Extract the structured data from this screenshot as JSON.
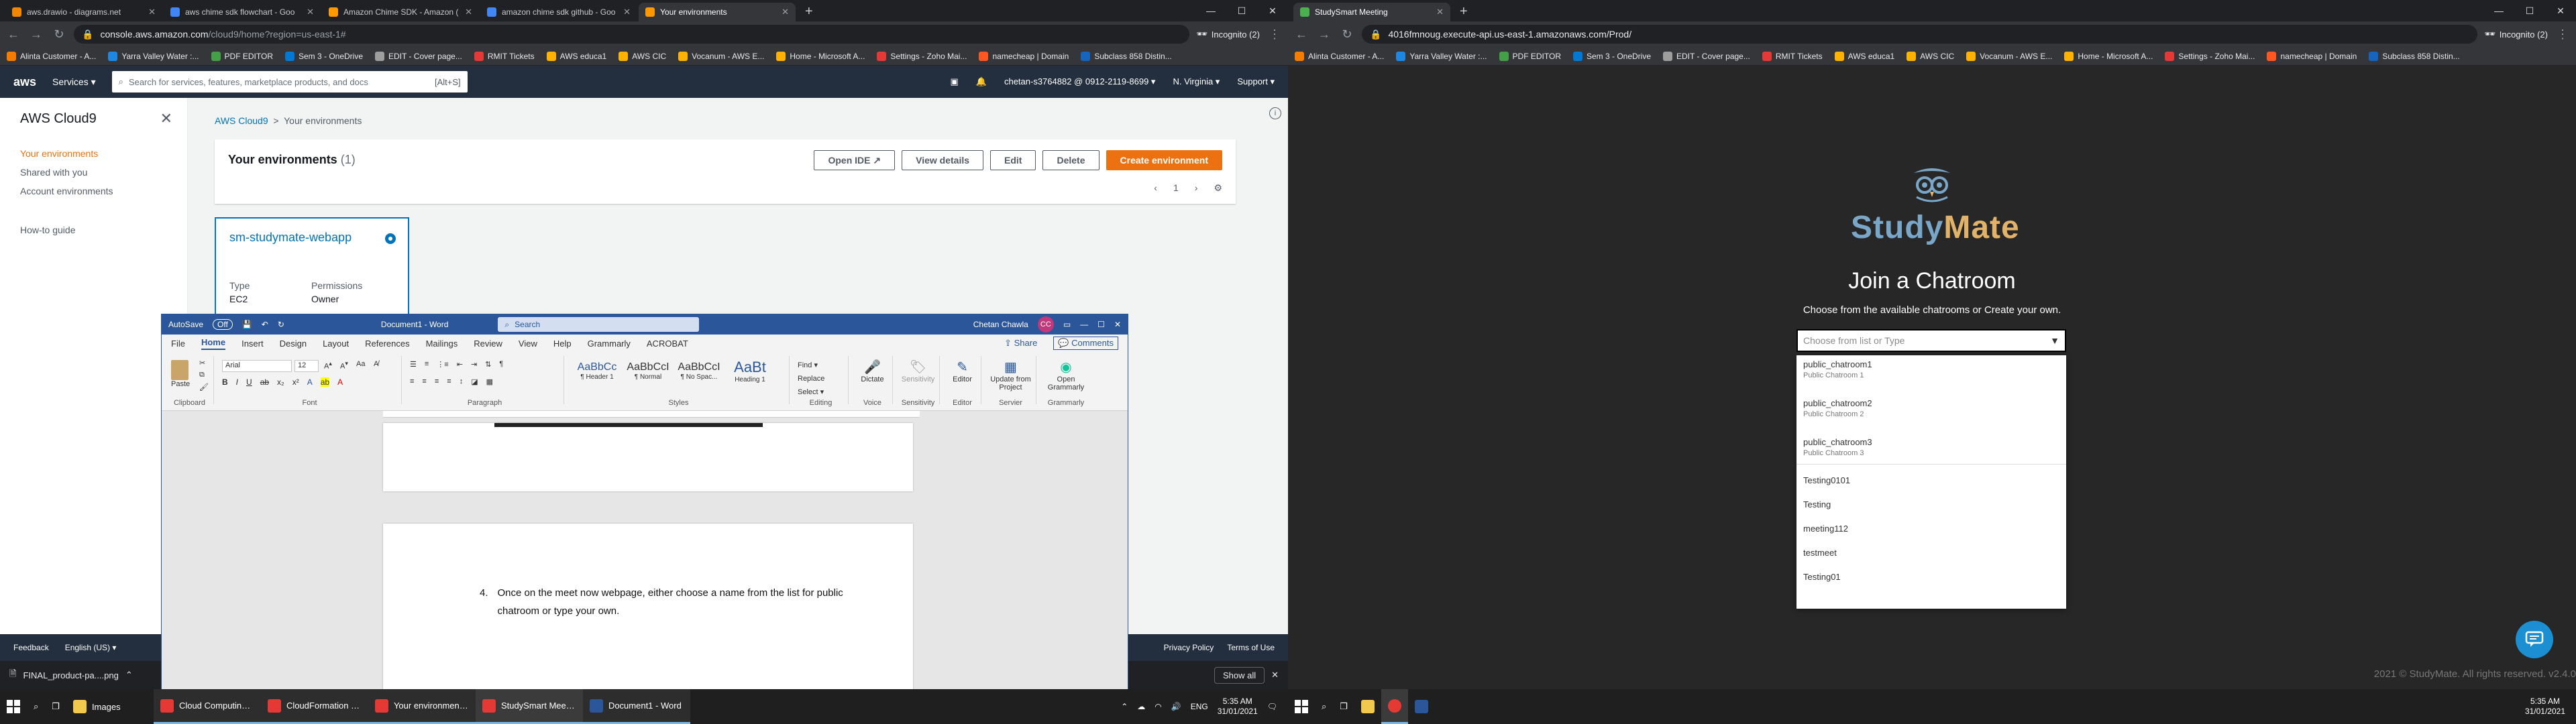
{
  "left_browser": {
    "tabs": [
      {
        "title": "aws.drawio - diagrams.net",
        "color": "#f08705"
      },
      {
        "title": "aws chime sdk flowchart - Goo",
        "color": "#4285f4"
      },
      {
        "title": "Amazon Chime SDK - Amazon (",
        "color": "#ff9900"
      },
      {
        "title": "amazon chime sdk github - Goo",
        "color": "#4285f4"
      },
      {
        "title": "Your environments",
        "color": "#ff9900"
      }
    ],
    "new_tab": "+",
    "url_host": "console.aws.amazon.com",
    "url_rest": "/cloud9/home?region=us-east-1#",
    "incognito": "Incognito (2)",
    "bookmarks": [
      {
        "label": "Alinta Customer - A...",
        "color": "#f57c00"
      },
      {
        "label": "Yarra Valley Water :...",
        "color": "#1e88e5"
      },
      {
        "label": "PDF EDITOR",
        "color": "#43a047"
      },
      {
        "label": "Sem 3 - OneDrive",
        "color": "#0078d4"
      },
      {
        "label": "EDIT - Cover page...",
        "color": "#9e9e9e"
      },
      {
        "label": "RMIT Tickets",
        "color": "#e53935"
      },
      {
        "label": "AWS educa1",
        "color": "#ffb300"
      },
      {
        "label": "AWS CIC",
        "color": "#ffb300"
      },
      {
        "label": "Vocanum - AWS E...",
        "color": "#ffb300"
      },
      {
        "label": "Home - Microsoft A...",
        "color": "#ffb300"
      },
      {
        "label": "Settings - Zoho Mai...",
        "color": "#e53935"
      },
      {
        "label": "namecheap | Domain",
        "color": "#ff5722"
      },
      {
        "label": "Subclass 858 Distin...",
        "color": "#1565c0"
      }
    ]
  },
  "right_browser": {
    "tabs": [
      {
        "title": "StudySmart Meeting",
        "color": "#4caf50"
      }
    ],
    "new_tab": "+",
    "url": "4016fmnoug.execute-api.us-east-1.amazonaws.com/Prod/",
    "incognito": "Incognito (2)"
  },
  "aws": {
    "logo": "aws",
    "services": "Services ▾",
    "search_placeholder": "Search for services, features, marketplace products, and docs",
    "search_shortcut": "[Alt+S]",
    "account": "chetan-s3764882 @ 0912-2119-8699 ▾",
    "region": "N. Virginia ▾",
    "support": "Support ▾",
    "sidebar": {
      "title": "AWS Cloud9",
      "items": [
        "Your environments",
        "Shared with you",
        "Account environments"
      ],
      "howto": "How-to guide"
    },
    "breadcrumb": {
      "root": "AWS Cloud9",
      "sep": ">",
      "current": "Your environments"
    },
    "panel": {
      "title": "Your environments",
      "count": "(1)",
      "buttons": {
        "open_ide": "Open IDE ↗",
        "view_details": "View details",
        "edit": "Edit",
        "delete": "Delete",
        "create": "Create environment"
      },
      "page": "1"
    },
    "card": {
      "name": "sm-studymate-webapp",
      "type_label": "Type",
      "type_value": "EC2",
      "perm_label": "Permissions",
      "perm_value": "Owner"
    },
    "footer": {
      "feedback": "Feedback",
      "language": "English (US) ▾",
      "privacy": "Privacy Policy",
      "terms": "Terms of Use"
    }
  },
  "download": {
    "file": "FINAL_product-pa....png",
    "show_all": "Show all"
  },
  "word": {
    "autosave": "AutoSave",
    "autosave_state": "Off",
    "doc_title": "Document1 - Word",
    "search": "Search",
    "user": "Chetan Chawla",
    "initials": "CC",
    "menu": [
      "File",
      "Home",
      "Insert",
      "Design",
      "Layout",
      "References",
      "Mailings",
      "Review",
      "View",
      "Help",
      "Grammarly",
      "ACROBAT"
    ],
    "share": "Share",
    "comments": "Comments",
    "font": "Arial",
    "size": "12",
    "paste": "Paste",
    "styles": [
      {
        "preview": "AaBbCc",
        "name": "¶ Header 1"
      },
      {
        "preview": "AaBbCcI",
        "name": "¶ Normal"
      },
      {
        "preview": "AaBbCcI",
        "name": "¶ No Spac..."
      },
      {
        "preview": "AaBt",
        "name": "Heading 1"
      }
    ],
    "editing": [
      "Find ▾",
      "Replace",
      "Select ▾"
    ],
    "tools": [
      "Dictate",
      "Sensitivity",
      "Editor",
      "Update from Project",
      "Open Grammarly"
    ],
    "groups": [
      "Clipboard",
      "Font",
      "Paragraph",
      "Styles",
      "Editing",
      "Voice",
      "Sensitivity",
      "Editor",
      "Servier",
      "Grammarly"
    ],
    "step_number": "4.",
    "step_text": "Once on the meet now webpage, either choose a name from the list for public chatroom or type your own."
  },
  "studymate": {
    "brand_1": "Study",
    "brand_2": "Mate",
    "heading": "Join a Chatroom",
    "subheading": "Choose from the available chatrooms or Create your own.",
    "placeholder": "Choose from list or Type",
    "public_options": [
      {
        "name": "public_chatroom1",
        "desc": "Public Chatroom 1"
      },
      {
        "name": "public_chatroom2",
        "desc": "Public Chatroom 2"
      },
      {
        "name": "public_chatroom3",
        "desc": "Public Chatroom 3"
      }
    ],
    "other_options": [
      "Testing0101",
      "Testing",
      "meeting112",
      "testmeet",
      "Testing01"
    ],
    "footer": "2021 © StudyMate. All rights reserved. v2.4.0"
  },
  "taskbar_left": {
    "apps": [
      {
        "label": "Images",
        "color": "#f2c94c"
      },
      {
        "label": "Cloud Computing ...",
        "color": "#e53935"
      },
      {
        "label": "CloudFormation - ...",
        "color": "#e53935"
      },
      {
        "label": "Your environments ...",
        "color": "#e53935"
      },
      {
        "label": "StudySmart Meetin...",
        "color": "#e53935"
      },
      {
        "label": "Document1 - Word",
        "color": "#2b579a"
      }
    ],
    "lang": "ENG",
    "time": "5:35 AM",
    "date": "31/01/2021"
  },
  "taskbar_right": {
    "time": "5:35 AM",
    "date": "31/01/2021"
  }
}
